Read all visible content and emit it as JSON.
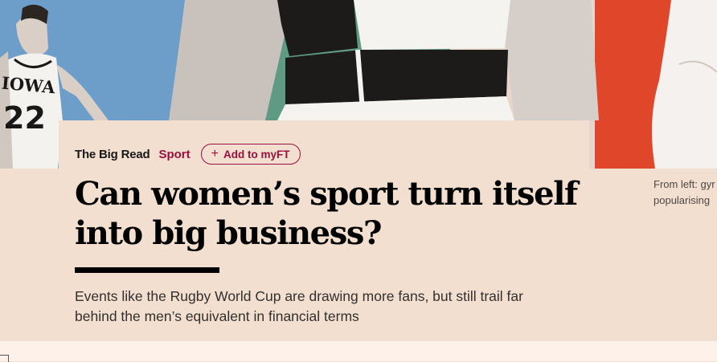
{
  "article": {
    "series": "The Big Read",
    "topic": "Sport",
    "add_to_myft": "Add to myFT",
    "title": "Can women’s sport turn itself into big business?",
    "standfirst": "Events like the Rugby World Cup are drawing more fans, but still trail far behind the men’s equivalent in financial terms",
    "caption_line1": "From left: gyr",
    "caption_line2": "popularising"
  },
  "hero_image": {
    "jersey_team": "IOWA",
    "jersey_number": "22"
  },
  "colors": {
    "background": "#f2dfcf",
    "accent": "#990f3d",
    "hero_blue": "#6d9dc9",
    "hero_green": "#5e9a84",
    "hero_red": "#e0472a"
  },
  "icons": {
    "add": "plus-icon"
  }
}
